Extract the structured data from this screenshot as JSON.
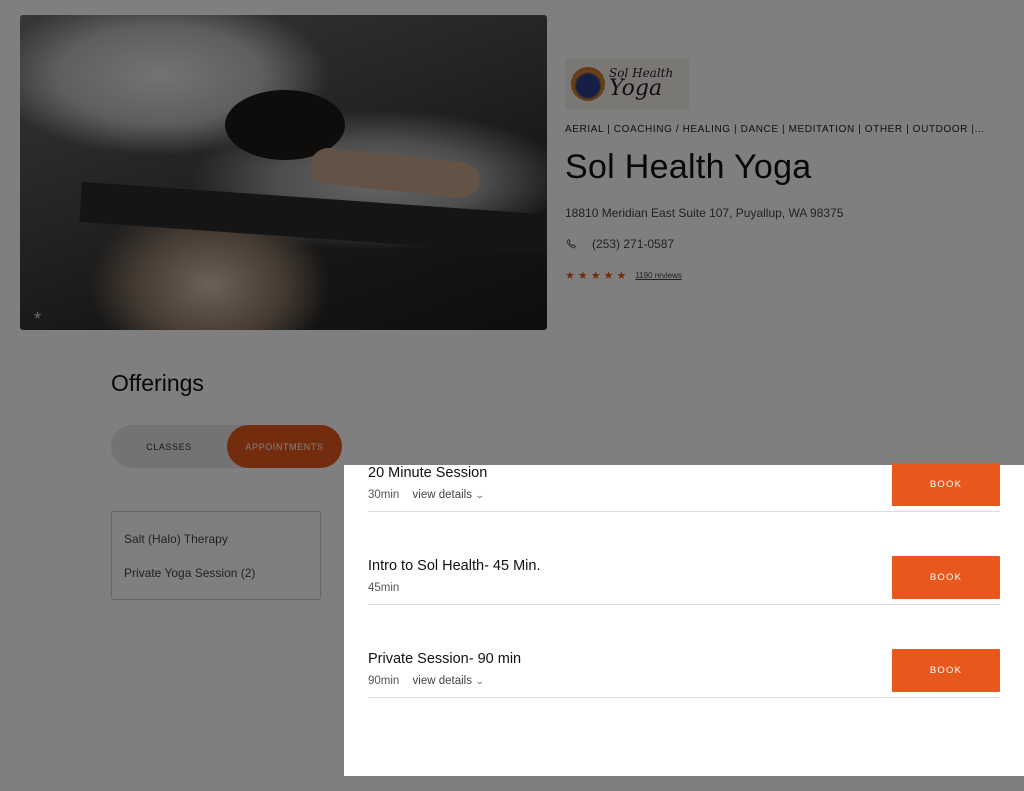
{
  "studio": {
    "logo_text_line1": "Sol Health",
    "logo_text_line2": "Yoga",
    "categories": "AERIAL | COACHING / HEALING | DANCE | MEDITATION | OTHER | OUTDOOR |...",
    "name": "Sol Health Yoga",
    "address": "18810 Meridian East Suite 107, Puyallup, WA 98375",
    "phone": "(253) 271-0587",
    "rating_stars": "★★★★★",
    "reviews_label": "1190 reviews"
  },
  "hero": {
    "overlay_mark": "*"
  },
  "offerings": {
    "title": "Offerings",
    "tabs": [
      {
        "label": "CLASSES",
        "active": false
      },
      {
        "label": "APPOINTMENTS",
        "active": true
      }
    ],
    "filters": [
      {
        "label": "Salt (Halo) Therapy"
      },
      {
        "label": "Private Yoga Session (2)"
      }
    ],
    "appointments": [
      {
        "title": "20 Minute Session",
        "duration": "30min",
        "details_label": "view details",
        "book_label": "BOOK"
      },
      {
        "title": "Intro to Sol Health- 45 Min.",
        "duration": "45min",
        "details_label": "",
        "book_label": "BOOK"
      },
      {
        "title": "Private Session- 90 min",
        "duration": "90min",
        "details_label": "view details",
        "book_label": "BOOK"
      }
    ]
  },
  "colors": {
    "accent": "#e8581c",
    "overlay": "rgba(0,0,0,0.5)"
  },
  "icons": {
    "phone": "phone-icon",
    "star": "star-icon",
    "chevron": "chevron-down-icon"
  }
}
